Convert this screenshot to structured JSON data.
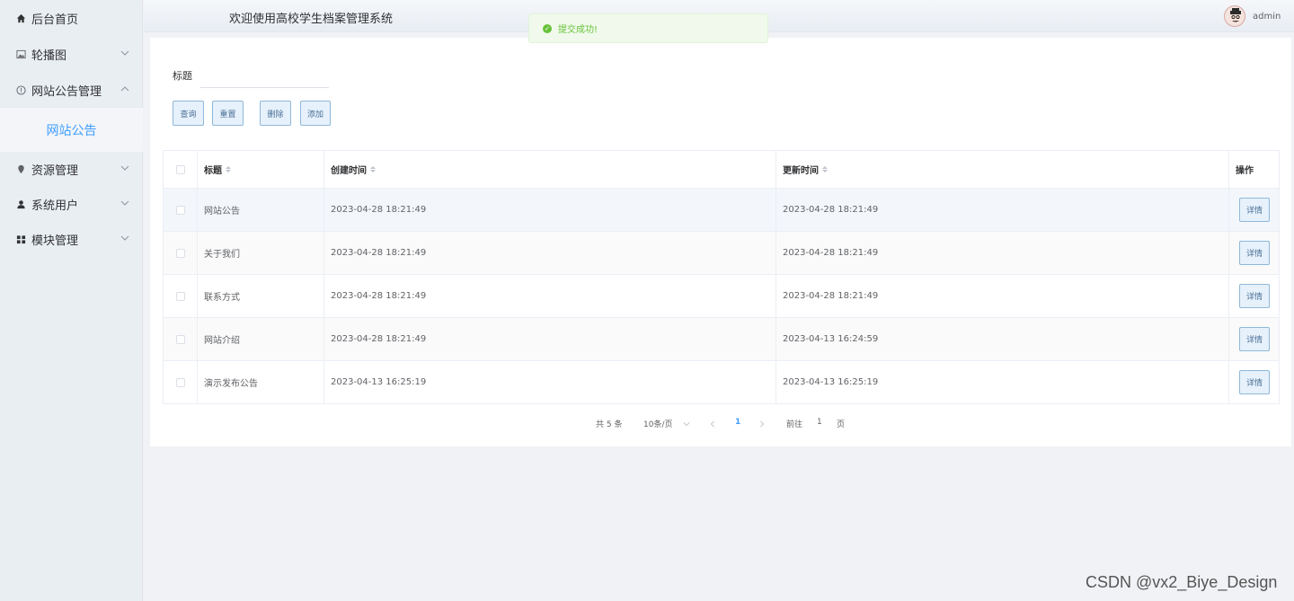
{
  "sidebar": {
    "items": [
      {
        "label": "后台首页",
        "icon": "home-icon"
      },
      {
        "label": "轮播图",
        "icon": "image-icon"
      },
      {
        "label": "网站公告管理",
        "icon": "info-icon"
      },
      {
        "label": "资源管理",
        "icon": "location-icon"
      },
      {
        "label": "系统用户",
        "icon": "user-icon"
      },
      {
        "label": "模块管理",
        "icon": "grid-icon"
      }
    ],
    "active_submenu": "网站公告"
  },
  "header": {
    "title": "欢迎使用高校学生档案管理系统",
    "username": "admin"
  },
  "toast": {
    "message": "提交成功!"
  },
  "search": {
    "label": "标题",
    "value": ""
  },
  "toolbar": {
    "query_label": "查询",
    "reset_label": "重置",
    "delete_label": "删除",
    "add_label": "添加"
  },
  "table": {
    "columns": [
      "标题",
      "创建时间",
      "更新时间",
      "操作"
    ],
    "rows": [
      {
        "title": "网站公告",
        "created": "2023-04-28 18:21:49",
        "updated": "2023-04-28 18:21:49"
      },
      {
        "title": "关于我们",
        "created": "2023-04-28 18:21:49",
        "updated": "2023-04-28 18:21:49"
      },
      {
        "title": "联系方式",
        "created": "2023-04-28 18:21:49",
        "updated": "2023-04-28 18:21:49"
      },
      {
        "title": "网站介绍",
        "created": "2023-04-28 18:21:49",
        "updated": "2023-04-13 16:24:59"
      },
      {
        "title": "演示发布公告",
        "created": "2023-04-13 16:25:19",
        "updated": "2023-04-13 16:25:19"
      }
    ],
    "detail_label": "详情"
  },
  "pagination": {
    "total": "共 5 条",
    "page_size": "10条/页",
    "current_page": "1",
    "goto_prefix": "前往",
    "goto_value": "1",
    "goto_suffix": "页"
  },
  "watermark": "CSDN @vx2_Biye_Design",
  "colors": {
    "accent": "#409eff",
    "success": "#67c23a",
    "sidebar_bg": "#e9eef3"
  }
}
